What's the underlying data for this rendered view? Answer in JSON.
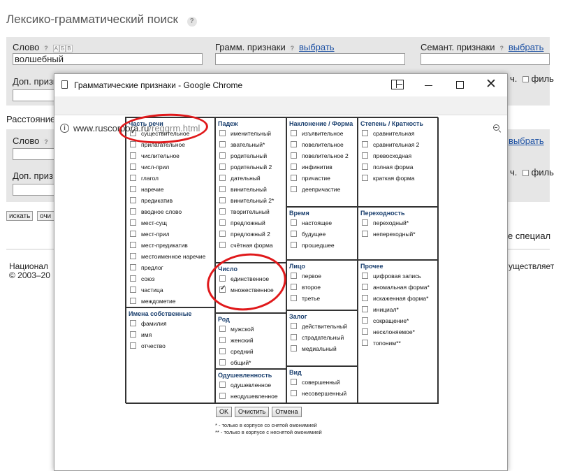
{
  "page": {
    "title": "Лексико-грамматический поиск",
    "help": "?"
  },
  "form": {
    "word_label": "Слово",
    "kbd_keys": [
      "А",
      "Б",
      "В"
    ],
    "word_value": "волшебный",
    "gram_label": "Грамм. признаки",
    "sem_label": "Семант. признаки",
    "choose_link": "выбрать",
    "extra_label_cut": "Доп. призн",
    "extra_label_cut2": "Доп. приз",
    "distance_label_cut": "Расстояние",
    "word2_label": "Слово",
    "filter_cut": "ч.",
    "filter_label_cut": "филь",
    "search_button": "искать",
    "clear_button_cut": "очи",
    "special_cut": "е специал",
    "footer_org_cut": "Национал",
    "footer_copy_cut": "© 2003–20",
    "footer_right_cut": "уществляет"
  },
  "popup": {
    "title": "Грамматические признаки - Google Chrome",
    "url_host": "www.ruscorpora.ru",
    "url_path": "/reggrm.html"
  },
  "grid": {
    "sections": [
      {
        "title": "Часть речи",
        "options": [
          {
            "label": "существительное",
            "checked": true
          },
          {
            "label": "прилагательное",
            "checked": false
          },
          {
            "label": "числительное",
            "checked": false
          },
          {
            "label": "числ-прил",
            "checked": false
          },
          {
            "label": "глагол",
            "checked": false
          },
          {
            "label": "наречие",
            "checked": false
          },
          {
            "label": "предикатив",
            "checked": false
          },
          {
            "label": "вводное слово",
            "checked": false
          },
          {
            "label": "мест-сущ",
            "checked": false
          },
          {
            "label": "мест-прил",
            "checked": false
          },
          {
            "label": "мест-предикатив",
            "checked": false
          },
          {
            "label": "местоименное наречие",
            "checked": false
          },
          {
            "label": "предлог",
            "checked": false
          },
          {
            "label": "союз",
            "checked": false
          },
          {
            "label": "частица",
            "checked": false
          },
          {
            "label": "междометие",
            "checked": false
          }
        ]
      },
      {
        "title": "Падеж",
        "options": [
          {
            "label": "именительный",
            "checked": false
          },
          {
            "label": "звательный*",
            "checked": false
          },
          {
            "label": "родительный",
            "checked": false
          },
          {
            "label": "родительный 2",
            "checked": false
          },
          {
            "label": "дательный",
            "checked": false
          },
          {
            "label": "винительный",
            "checked": false
          },
          {
            "label": "винительный 2*",
            "checked": false
          },
          {
            "label": "творительный",
            "checked": false
          },
          {
            "label": "предложный",
            "checked": false
          },
          {
            "label": "предложный 2",
            "checked": false
          },
          {
            "label": "счётная форма",
            "checked": false
          }
        ]
      },
      {
        "title": "Наклонение / Форма",
        "options": [
          {
            "label": "изъявительное",
            "checked": false
          },
          {
            "label": "повелительное",
            "checked": false
          },
          {
            "label": "повелительное 2",
            "checked": false
          },
          {
            "label": "инфинитив",
            "checked": false
          },
          {
            "label": "причастие",
            "checked": false
          },
          {
            "label": "деепричастие",
            "checked": false
          }
        ]
      },
      {
        "title": "Степень / Краткость",
        "options": [
          {
            "label": "сравнительная",
            "checked": false
          },
          {
            "label": "сравнительная 2",
            "checked": false
          },
          {
            "label": "превосходная",
            "checked": false
          },
          {
            "label": "полная форма",
            "checked": false
          },
          {
            "label": "краткая форма",
            "checked": false
          }
        ]
      },
      {
        "title": "Время",
        "options": [
          {
            "label": "настоящее",
            "checked": false
          },
          {
            "label": "будущее",
            "checked": false
          },
          {
            "label": "прошедшее",
            "checked": false
          }
        ]
      },
      {
        "title": "Переходность",
        "options": [
          {
            "label": "переходный*",
            "checked": false
          },
          {
            "label": "непереходный*",
            "checked": false
          }
        ]
      },
      {
        "title": "Число",
        "options": [
          {
            "label": "единственное",
            "checked": false
          },
          {
            "label": "множественное",
            "checked": true
          }
        ]
      },
      {
        "title": "Лицо",
        "options": [
          {
            "label": "первое",
            "checked": false
          },
          {
            "label": "второе",
            "checked": false
          },
          {
            "label": "третье",
            "checked": false
          }
        ]
      },
      {
        "title": "Прочее",
        "options": [
          {
            "label": "цифровая запись",
            "checked": false
          },
          {
            "label": "аномальная форма*",
            "checked": false
          },
          {
            "label": "искаженная форма*",
            "checked": false
          },
          {
            "label": "инициал*",
            "checked": false
          },
          {
            "label": "сокращение*",
            "checked": false
          },
          {
            "label": "несклоняемое*",
            "checked": false
          },
          {
            "label": "топоним**",
            "checked": false
          }
        ]
      },
      {
        "title": "Имена собственные",
        "options": [
          {
            "label": "фамилия",
            "checked": false
          },
          {
            "label": "имя",
            "checked": false
          },
          {
            "label": "отчество",
            "checked": false
          }
        ]
      },
      {
        "title": "Род",
        "options": [
          {
            "label": "мужской",
            "checked": false
          },
          {
            "label": "женский",
            "checked": false
          },
          {
            "label": "средний",
            "checked": false
          },
          {
            "label": "общий*",
            "checked": false
          }
        ]
      },
      {
        "title": "Залог",
        "options": [
          {
            "label": "действительный",
            "checked": false
          },
          {
            "label": "страдательный",
            "checked": false
          },
          {
            "label": "медиальный",
            "checked": false
          }
        ]
      },
      {
        "title": "Одушевленность",
        "options": [
          {
            "label": "одушевленное",
            "checked": false
          },
          {
            "label": "неодушевленное",
            "checked": false
          }
        ]
      },
      {
        "title": "Вид",
        "options": [
          {
            "label": "совершенный",
            "checked": false
          },
          {
            "label": "несовершенный",
            "checked": false
          }
        ]
      }
    ]
  },
  "buttons": {
    "ok": "OK",
    "clear": "Очистить",
    "cancel": "Отмена"
  },
  "notes": {
    "single_star": "* - только в корпусе со снятой омонимией",
    "double_star": "** - только в корпусе с неснятой омонимией"
  },
  "colors": {
    "annotation_red": "#e0191b",
    "section_title": "#1a3f6e",
    "link": "#1a4fa3"
  }
}
